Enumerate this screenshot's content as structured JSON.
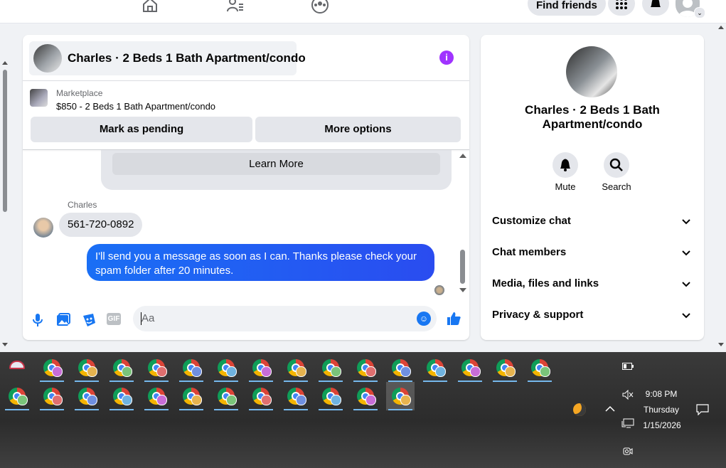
{
  "topnav": {
    "find_friends_label": "Find friends"
  },
  "chat": {
    "header_title": "Charles · 2 Beds 1 Bath Apartment/condo",
    "marketplace_label": "Marketplace",
    "listing_text": "$850 - 2 Beds 1 Bath Apartment/condo",
    "mark_pending_label": "Mark as pending",
    "more_options_label": "More options",
    "learn_more_label": "Learn More",
    "sender_name": "Charles",
    "incoming_message": "561-720-0892",
    "outgoing_message": "I'll send you a message as soon as I can. Thanks please check your spam folder after 20 minutes.",
    "composer_placeholder": "Aa",
    "gif_label": "GIF"
  },
  "info_panel": {
    "title": "Charles · 2 Beds 1 Bath Apartment/condo",
    "mute_label": "Mute",
    "search_label": "Search",
    "sections": [
      "Customize chat",
      "Chat members",
      "Media, files and links",
      "Privacy & support"
    ]
  },
  "taskbar": {
    "time": "9:08 PM",
    "day": "Thursday",
    "date": "1/15/2026"
  },
  "colors": {
    "brand_blue": "#1877f2",
    "info_purple": "#a033ff",
    "outgoing_bubble": "#1a6ff5"
  }
}
